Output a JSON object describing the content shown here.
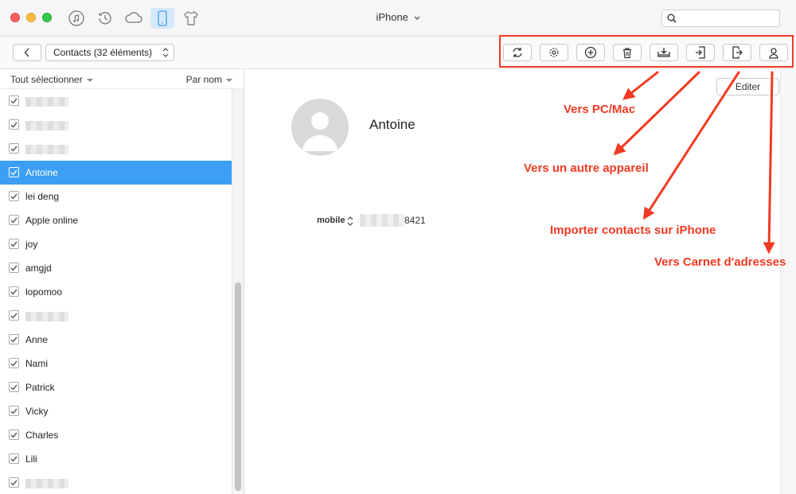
{
  "window": {
    "title": "iPhone",
    "nav_icons": [
      "music-icon",
      "history-icon",
      "cloud-icon",
      "phone-icon",
      "tshirt-icon"
    ],
    "active_nav": "phone-icon",
    "search_placeholder": ""
  },
  "toolbar": {
    "category_select": "Contacts (32 éléments)",
    "actions": [
      "refresh-icon",
      "gear-icon",
      "add-icon",
      "trash-icon",
      "export-to-pc-icon",
      "export-to-device-icon",
      "import-to-iphone-icon",
      "address-book-icon"
    ]
  },
  "sidebar": {
    "select_all": "Tout sélectionner",
    "sort_by": "Par nom",
    "items": [
      {
        "label": "",
        "checked": true,
        "blurred": true
      },
      {
        "label": "",
        "checked": true,
        "blurred": true
      },
      {
        "label": "",
        "checked": true,
        "blurred": true
      },
      {
        "label": "Antoine",
        "checked": true,
        "selected": true
      },
      {
        "label": "lei deng",
        "checked": true
      },
      {
        "label": "Apple online",
        "checked": true
      },
      {
        "label": "joy",
        "checked": true
      },
      {
        "label": "amgjd",
        "checked": true
      },
      {
        "label": "lopomoo",
        "checked": true
      },
      {
        "label": "",
        "checked": true,
        "blurred": true
      },
      {
        "label": "Anne",
        "checked": true
      },
      {
        "label": "Nami",
        "checked": true
      },
      {
        "label": "Patrick",
        "checked": true
      },
      {
        "label": "Vicky",
        "checked": true
      },
      {
        "label": "Charles",
        "checked": true
      },
      {
        "label": "Lili",
        "checked": true
      },
      {
        "label": "",
        "checked": true,
        "blurred": true
      }
    ]
  },
  "detail": {
    "edit_label": "Editer",
    "name": "Antoine",
    "phone_label": "mobile",
    "phone_suffix": "8421"
  },
  "annotations": {
    "to_pc": "Vers PC/Mac",
    "to_device": "Vers un autre appareil",
    "import": "Importer contacts sur iPhone",
    "to_address_book": "Vers Carnet d'adresses"
  },
  "colors": {
    "accent": "#3d9ff3",
    "annotation": "#f13a23"
  }
}
